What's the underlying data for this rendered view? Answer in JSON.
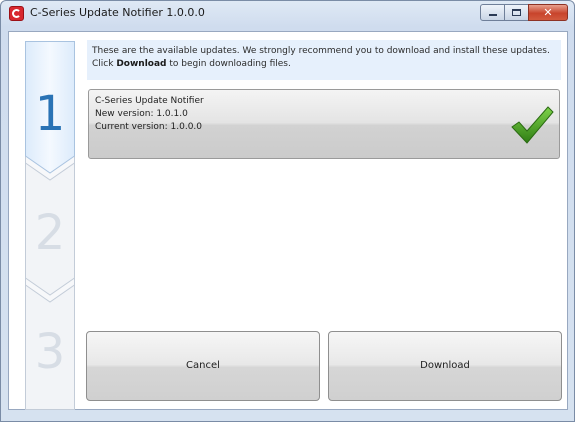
{
  "window": {
    "title": "C-Series Update Notifier 1.0.0.0",
    "close_glyph": "✕"
  },
  "steps": [
    "1",
    "2",
    "3"
  ],
  "active_step": 1,
  "info": {
    "text_before": "These are the available updates. We strongly recommend you to download and install these updates. Click ",
    "bold": "Download",
    "text_after": " to begin downloading files."
  },
  "update": {
    "name": "C-Series Update Notifier",
    "new_version": "New version: 1.0.1.0",
    "current_version": "Current version: 1.0.0.0",
    "status_icon": "checkmark-icon"
  },
  "buttons": {
    "cancel_label": "Cancel",
    "download_label": "Download"
  },
  "colors": {
    "accent": "#2a73b5",
    "check": "#3f9a1e"
  }
}
